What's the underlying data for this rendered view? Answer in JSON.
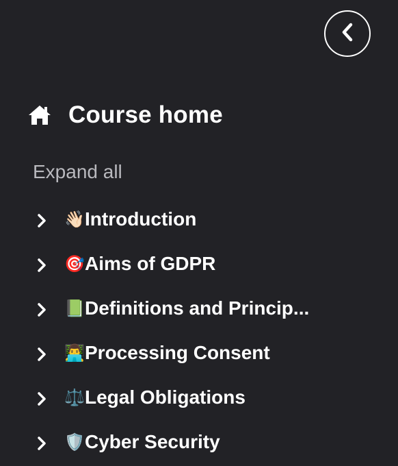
{
  "header": {
    "close_button_icon": "chevron-left-icon"
  },
  "course_home": {
    "icon": "home-icon",
    "label": "Course home"
  },
  "expand_all": {
    "label": "Expand all"
  },
  "sections": [
    {
      "emoji": "👋🏻",
      "label": "Introduction"
    },
    {
      "emoji": "🎯",
      "label": "Aims of GDPR"
    },
    {
      "emoji": "📗",
      "label": "Definitions and Princip..."
    },
    {
      "emoji": "👨‍💻",
      "label": "Processing Consent"
    },
    {
      "emoji": "⚖️",
      "label": "Legal Obligations"
    },
    {
      "emoji": "🛡️",
      "label": "Cyber Security"
    }
  ],
  "colors": {
    "background": "#222226",
    "text": "#ffffff",
    "muted_text": "#b9b9be"
  }
}
